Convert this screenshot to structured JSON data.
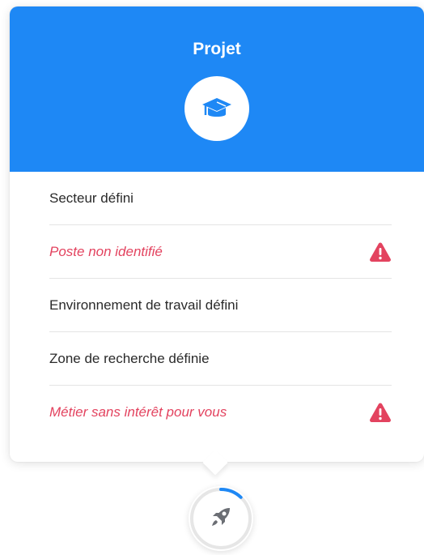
{
  "card": {
    "title": "Projet",
    "header_color": "#1e88f5",
    "header_icon": "graduation-cap-icon",
    "items": [
      {
        "label": "Secteur défini",
        "status": "ok"
      },
      {
        "label": "Poste non identifié",
        "status": "warning"
      },
      {
        "label": "Environnement de travail défini",
        "status": "ok"
      },
      {
        "label": "Zone de recherche définie",
        "status": "ok"
      },
      {
        "label": "Métier sans intérêt pour vous",
        "status": "warning"
      }
    ],
    "warning_color": "#e3435f"
  },
  "fab": {
    "icon": "rocket-icon",
    "progress": 0.12,
    "progress_color": "#1e88f5"
  }
}
